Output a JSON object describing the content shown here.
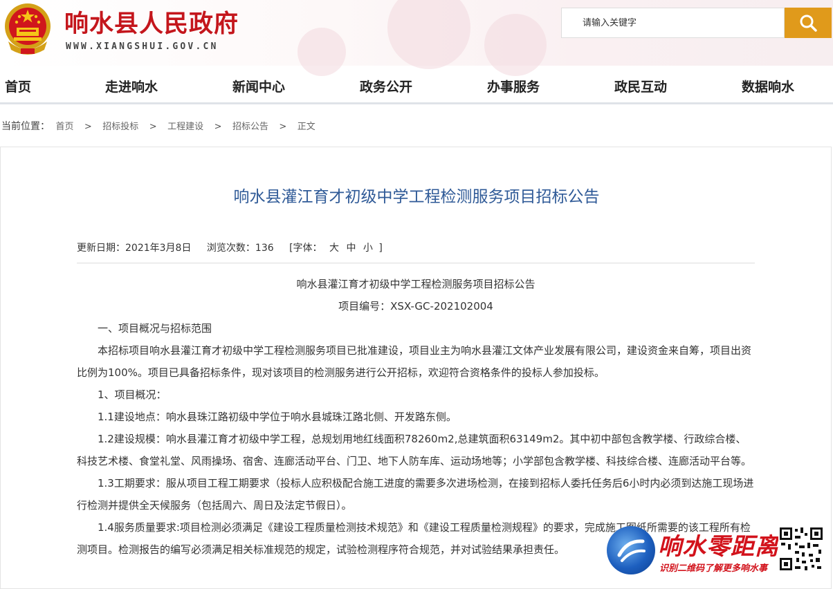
{
  "header": {
    "site_title": "响水县人民政府",
    "site_url": "WWW.XIANGSHUI.GOV.CN",
    "search_placeholder": "请输入关键字"
  },
  "nav": {
    "items": [
      "首页",
      "走进响水",
      "新闻中心",
      "政务公开",
      "办事服务",
      "政民互动",
      "数据响水"
    ]
  },
  "breadcrumb": {
    "label": "当前位置：",
    "items": [
      "首页",
      "招标投标",
      "工程建设",
      "招标公告",
      "正文"
    ],
    "separator": ">"
  },
  "article": {
    "title": "响水县灌江育才初级中学工程检测服务项目招标公告",
    "update_label": "更新日期：2021年3月8日",
    "views_label": "浏览次数：136",
    "font_label": "[字体：",
    "font_large": "大",
    "font_medium": "中",
    "font_small": "小",
    "font_close": "]",
    "paragraphs": [
      "响水县灌江育才初级中学工程检测服务项目招标公告",
      "项目编号：XSX-GC-202102004",
      "一、项目概况与招标范围",
      "本招标项目响水县灌江育才初级中学工程检测服务项目已批准建设，项目业主为响水县灌江文体产业发展有限公司，建设资金来自筹，项目出资比例为100%。项目已具备招标条件，现对该项目的检测服务进行公开招标，欢迎符合资格条件的投标人参加投标。",
      "1、项目概况：",
      "1.1建设地点：响水县珠江路初级中学位于响水县城珠江路北侧、开发路东侧。",
      "1.2建设规模：响水县灌江育才初级中学工程，总规划用地红线面积78260m2,总建筑面积63149m2。其中初中部包含教学楼、行政综合楼、科技艺术楼、食堂礼堂、风雨操场、宿舍、连廊活动平台、门卫、地下人防车库、运动场地等；小学部包含教学楼、科技综合楼、连廊活动平台等。",
      "1.3工期要求：服从项目工程工期要求（投标人应积极配合施工进度的需要多次进场检测，在接到招标人委托任务后6小时内必须到达施工现场进行检测并提供全天候服务（包括周六、周日及法定节假日）。",
      "1.4服务质量要求:项目检测必须满足《建设工程质量检测技术规范》和《建设工程质量检测规程》的要求，完成施工图纸所需要的该工程所有检测项目。检测报告的编写必须满足相关标准规范的规定，试验检测程序符合规范，并对试验结果承担责任。"
    ]
  },
  "watermark": {
    "name": "响水零距离",
    "slogan": "识别二维码了解更多响水事"
  },
  "colors": {
    "title_red": "#c4161c",
    "accent_orange": "#e09a1b",
    "article_title_blue": "#2f5a97"
  }
}
